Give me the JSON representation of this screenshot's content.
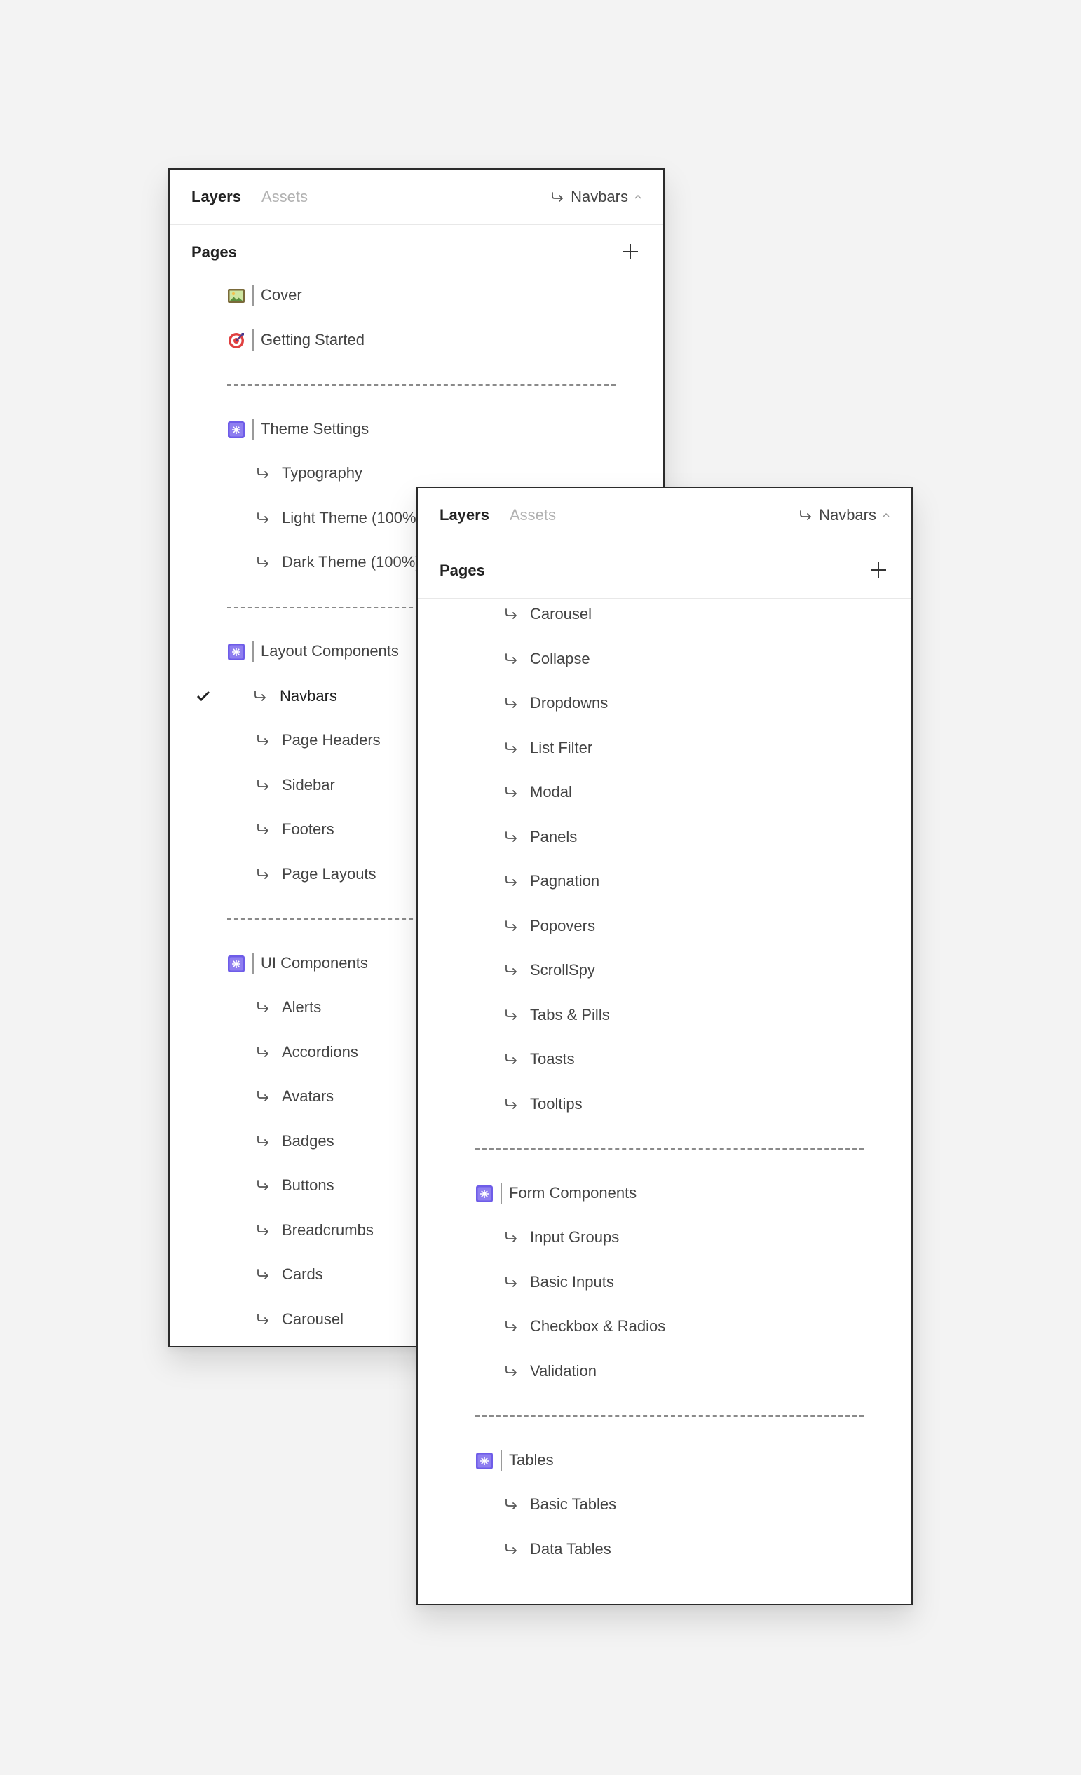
{
  "colors": {
    "background": "#f3f3f3",
    "panel": "#ffffff",
    "frame": "#2b2b2b",
    "muted_tab": "#b2b2b2",
    "icon_purple": "#6e5ce8"
  },
  "panel_a": {
    "header": {
      "tab_layers": "Layers",
      "tab_assets": "Assets",
      "current_page": "Navbars"
    },
    "pages_label": "Pages",
    "items": [
      {
        "kind": "group",
        "icon": "image-icon",
        "label": "Cover"
      },
      {
        "kind": "group",
        "icon": "target-icon",
        "label": "Getting Started"
      },
      {
        "kind": "separator",
        "label": ""
      },
      {
        "kind": "group",
        "icon": "component-icon",
        "label": "Theme Settings"
      },
      {
        "kind": "child",
        "label": "Typography"
      },
      {
        "kind": "child",
        "label": "Light Theme  (100%)"
      },
      {
        "kind": "child",
        "label": "Dark Theme  (100%)"
      },
      {
        "kind": "separator",
        "label": ""
      },
      {
        "kind": "group",
        "icon": "component-icon",
        "label": "Layout Components"
      },
      {
        "kind": "child",
        "label": "Navbars",
        "selected": true
      },
      {
        "kind": "child",
        "label": "Page Headers"
      },
      {
        "kind": "child",
        "label": "Sidebar"
      },
      {
        "kind": "child",
        "label": "Footers"
      },
      {
        "kind": "child",
        "label": "Page Layouts"
      },
      {
        "kind": "separator",
        "label": ""
      },
      {
        "kind": "group",
        "icon": "component-icon",
        "label": "UI Components"
      },
      {
        "kind": "child",
        "label": "Alerts"
      },
      {
        "kind": "child",
        "label": "Accordions"
      },
      {
        "kind": "child",
        "label": "Avatars"
      },
      {
        "kind": "child",
        "label": "Badges"
      },
      {
        "kind": "child",
        "label": "Buttons"
      },
      {
        "kind": "child",
        "label": "Breadcrumbs"
      },
      {
        "kind": "child",
        "label": "Cards"
      },
      {
        "kind": "child",
        "label": "Carousel"
      }
    ]
  },
  "panel_b": {
    "header": {
      "tab_layers": "Layers",
      "tab_assets": "Assets",
      "current_page": "Navbars"
    },
    "pages_label": "Pages",
    "items": [
      {
        "kind": "child",
        "label": "Carousel"
      },
      {
        "kind": "child",
        "label": "Collapse"
      },
      {
        "kind": "child",
        "label": "Dropdowns"
      },
      {
        "kind": "child",
        "label": "List Filter"
      },
      {
        "kind": "child",
        "label": "Modal"
      },
      {
        "kind": "child",
        "label": "Panels"
      },
      {
        "kind": "child",
        "label": "Pagnation"
      },
      {
        "kind": "child",
        "label": "Popovers"
      },
      {
        "kind": "child",
        "label": "ScrollSpy"
      },
      {
        "kind": "child",
        "label": "Tabs & Pills"
      },
      {
        "kind": "child",
        "label": "Toasts"
      },
      {
        "kind": "child",
        "label": "Tooltips"
      },
      {
        "kind": "separator",
        "label": ""
      },
      {
        "kind": "group",
        "icon": "component-icon",
        "label": "Form Components"
      },
      {
        "kind": "child",
        "label": "Input Groups"
      },
      {
        "kind": "child",
        "label": "Basic Inputs"
      },
      {
        "kind": "child",
        "label": "Checkbox & Radios"
      },
      {
        "kind": "child",
        "label": "Validation"
      },
      {
        "kind": "separator",
        "label": ""
      },
      {
        "kind": "group",
        "icon": "component-icon",
        "label": "Tables"
      },
      {
        "kind": "child",
        "label": "Basic Tables"
      },
      {
        "kind": "child",
        "label": "Data Tables"
      }
    ]
  }
}
